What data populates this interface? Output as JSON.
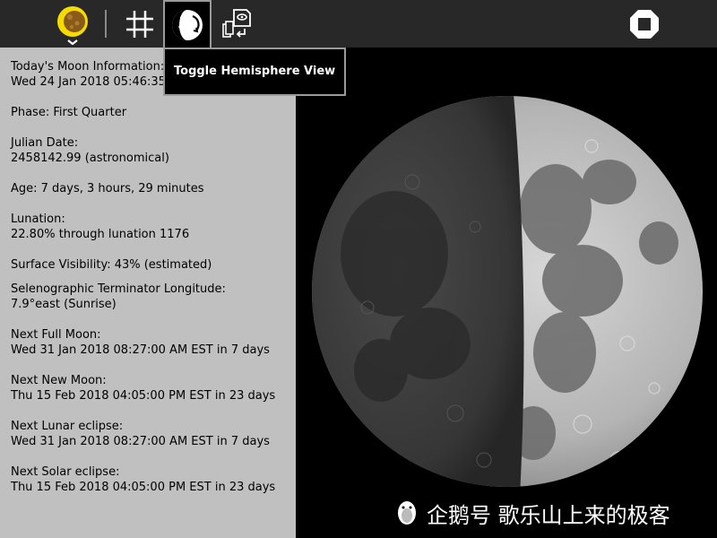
{
  "tooltip": "Toggle Hemisphere View",
  "toolbar": {
    "icons": [
      "moon-activity-icon",
      "grid-icon",
      "hemisphere-toggle-icon",
      "share-icon",
      "stop-icon"
    ],
    "activity_color": "#f5dc00"
  },
  "info": {
    "title": "Today's Moon Information:",
    "datetime": "Wed 24 Jan 2018 05:46:35",
    "phase": "Phase: First Quarter",
    "julian_label": "Julian Date:",
    "julian_value": "2458142.99 (astronomical)",
    "age": "Age: 7 days, 3 hours, 29 minutes",
    "lunation_label": "Lunation:",
    "lunation_value": "22.80% through lunation 1176",
    "surface": "Surface Visibility: 43% (estimated)",
    "terminator_label": "Selenographic Terminator Longitude:",
    "terminator_value": "7.9°east (Sunrise)",
    "full_label": "Next Full Moon:",
    "full_value": "Wed 31 Jan 2018 08:27:00 AM EST in 7 days",
    "new_label": "Next New Moon:",
    "new_value": "Thu 15 Feb 2018 04:05:00 PM EST in 23 days",
    "lunar_label": "Next Lunar eclipse:",
    "lunar_value": "Wed 31 Jan 2018 08:27:00 AM EST in 7 days",
    "solar_label": "Next Solar eclipse:",
    "solar_value": "Thu 15 Feb 2018 04:05:00 PM EST in 23 days"
  },
  "moon": {
    "illuminated_fraction": 0.43,
    "colors": {
      "lit": "#b8b8b8",
      "shadow": "#3a3a3a"
    }
  },
  "watermark": "企鹅号 歌乐山上来的极客"
}
